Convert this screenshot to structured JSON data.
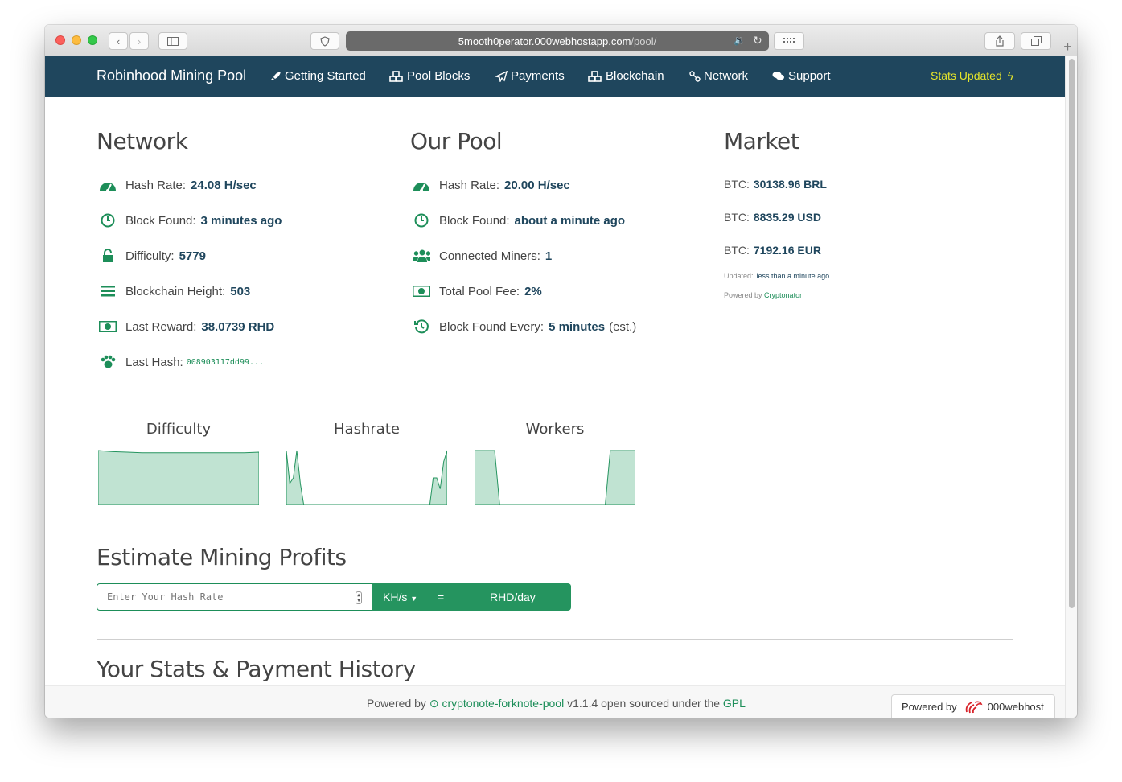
{
  "browser": {
    "url_host": "5mooth0perator.000webhostapp.com",
    "url_path": "/pool/"
  },
  "navbar": {
    "brand": "Robinhood Mining Pool",
    "items": [
      {
        "label": "Getting Started",
        "icon": "rocket-icon"
      },
      {
        "label": "Pool Blocks",
        "icon": "cubes-icon"
      },
      {
        "label": "Payments",
        "icon": "paper-plane-icon"
      },
      {
        "label": "Blockchain",
        "icon": "cubes-icon"
      },
      {
        "label": "Network",
        "icon": "sitemap-icon"
      },
      {
        "label": "Support",
        "icon": "comments-icon"
      }
    ],
    "stats_updated": "Stats Updated"
  },
  "network": {
    "title": "Network",
    "hash_rate_label": "Hash Rate:",
    "hash_rate": "24.08 H/sec",
    "block_found_label": "Block Found:",
    "block_found": "3 minutes ago",
    "difficulty_label": "Difficulty:",
    "difficulty": "5779",
    "height_label": "Blockchain Height:",
    "height": "503",
    "reward_label": "Last Reward:",
    "reward": "38.0739 RHD",
    "hash_label": "Last Hash:",
    "hash": "008903117dd99..."
  },
  "pool": {
    "title": "Our Pool",
    "hash_rate_label": "Hash Rate:",
    "hash_rate": "20.00 H/sec",
    "block_found_label": "Block Found:",
    "block_found": "about a minute ago",
    "miners_label": "Connected Miners:",
    "miners": "1",
    "fee_label": "Total Pool Fee:",
    "fee": "2%",
    "every_label": "Block Found Every:",
    "every": "5 minutes",
    "every_suffix": "(est.)"
  },
  "market": {
    "title": "Market",
    "rows": [
      {
        "label": "BTC:",
        "value": "30138.96 BRL"
      },
      {
        "label": "BTC:",
        "value": "8835.29 USD"
      },
      {
        "label": "BTC:",
        "value": "7192.16 EUR"
      }
    ],
    "updated_label": "Updated:",
    "updated_value": "less than a minute ago",
    "powered_label": "Powered by",
    "powered_link": "Cryptonator"
  },
  "charts": {
    "titles": [
      "Difficulty",
      "Hashrate",
      "Workers"
    ]
  },
  "chart_data": [
    {
      "type": "area",
      "title": "Difficulty",
      "values": [
        100,
        98,
        97,
        96,
        96,
        96,
        96,
        96,
        96,
        96,
        96,
        97
      ]
    },
    {
      "type": "area",
      "title": "Hashrate",
      "values": [
        100,
        40,
        50,
        100,
        40,
        0,
        0,
        0,
        0,
        0,
        0,
        0,
        0,
        0,
        0,
        0,
        0,
        0,
        0,
        0,
        0,
        0,
        0,
        0,
        0,
        0,
        0,
        0,
        0,
        0,
        0,
        0,
        0,
        0,
        0,
        0,
        0,
        0,
        0,
        0,
        0,
        0,
        50,
        50,
        30,
        80,
        100
      ]
    },
    {
      "type": "area",
      "title": "Workers",
      "values": [
        1,
        1,
        1,
        1,
        1,
        0,
        0,
        0,
        0,
        0,
        0,
        0,
        0,
        0,
        0,
        0,
        0,
        0,
        0,
        0,
        0,
        0,
        0,
        0,
        0,
        0,
        0,
        1,
        1,
        1,
        1,
        1,
        1
      ]
    }
  ],
  "estimate": {
    "title": "Estimate Mining Profits",
    "placeholder": "Enter Your Hash Rate",
    "unit": "KH/s",
    "equals": "=",
    "result_unit": "RHD/day"
  },
  "stats_history": {
    "title": "Your Stats & Payment History"
  },
  "footer": {
    "powered_by": "Powered by",
    "project": "cryptonote-forknote-pool",
    "version_text": "v1.1.4 open sourced under the",
    "license": "GPL",
    "badge_powered": "Powered by",
    "badge_brand": "000webhost"
  }
}
